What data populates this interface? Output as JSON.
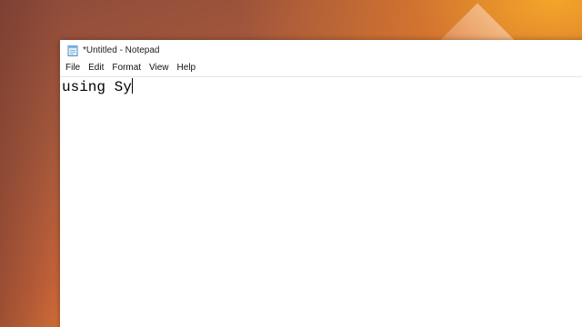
{
  "window": {
    "title": "*Untitled - Notepad",
    "icon": "notepad-icon"
  },
  "menubar": {
    "items": [
      "File",
      "Edit",
      "Format",
      "View",
      "Help"
    ]
  },
  "editor": {
    "text": "using Sy"
  },
  "colors": {
    "desktop_warm": "#e07a32",
    "desktop_dark": "#8c4a3a",
    "window_bg": "#ffffff"
  }
}
